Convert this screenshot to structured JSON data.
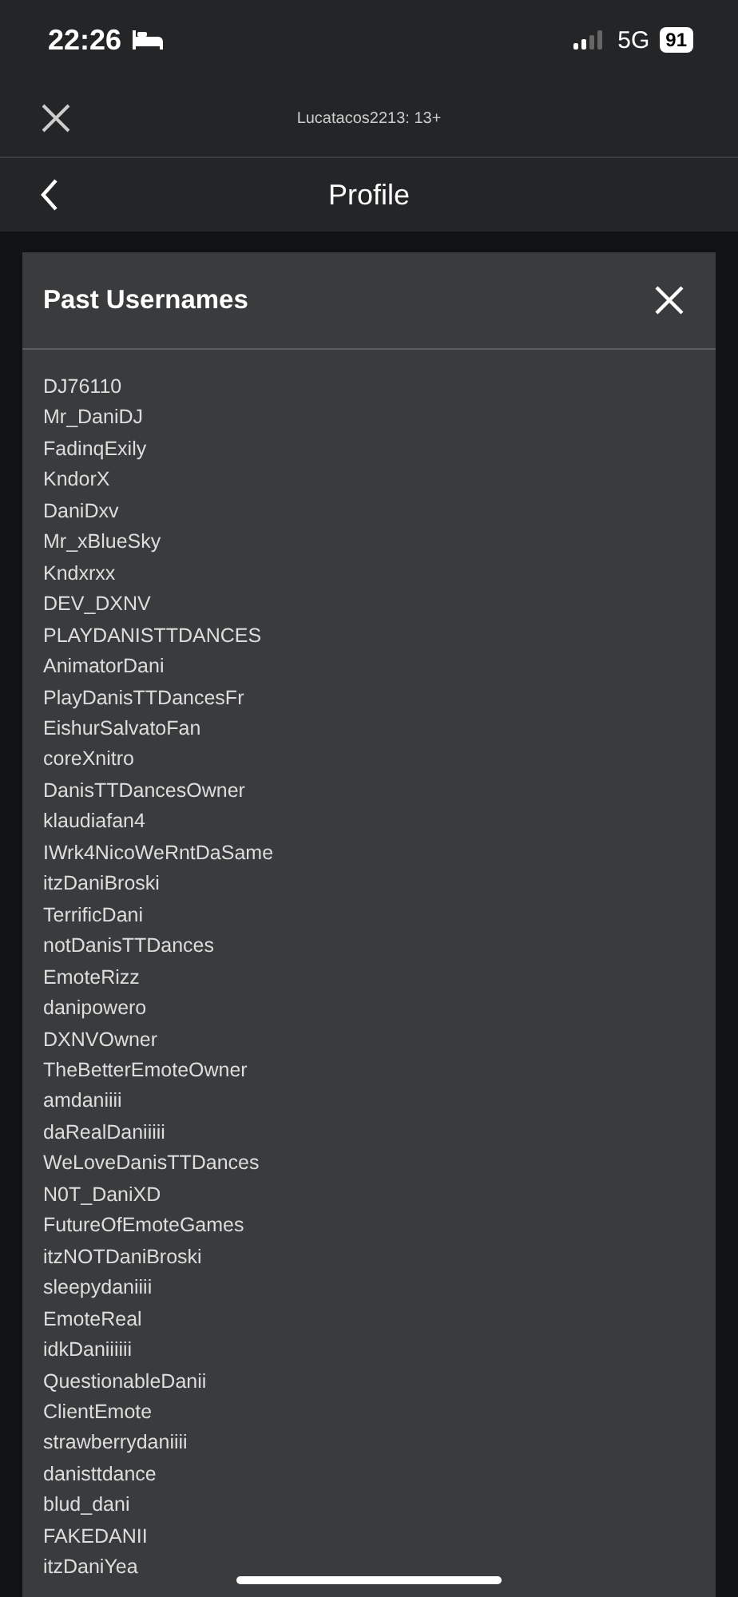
{
  "status_bar": {
    "time": "22:26",
    "network": "5G",
    "battery": "91"
  },
  "top_bar": {
    "title": "Lucatacos2213: 13+"
  },
  "header": {
    "title": "Profile"
  },
  "dialog": {
    "title": "Past Usernames",
    "usernames": [
      "DJ76110",
      "Mr_DaniDJ",
      "FadinqExily",
      "KndorX",
      "DaniDxv",
      "Mr_xBlueSky",
      "Kndxrxx",
      "DEV_DXNV",
      "PLAYDANISTTDANCES",
      "AnimatorDani",
      "PlayDanisTTDancesFr",
      "EishurSalvatoFan",
      "coreXnitro",
      "DanisTTDancesOwner",
      "klaudiafan4",
      "IWrk4NicoWeRntDaSame",
      "itzDaniBroski",
      "TerrificDani",
      "notDanisTTDances",
      "EmoteRizz",
      "danipowero",
      "DXNVOwner",
      "TheBetterEmoteOwner",
      "amdaniiii",
      "daRealDaniiiii",
      "WeLoveDanisTTDances",
      "N0T_DaniXD",
      "FutureOfEmoteGames",
      "itzNOTDaniBroski",
      "sleepydaniiii",
      "EmoteReal",
      "idkDaniiiiii",
      "QuestionableDanii",
      "ClientEmote",
      "strawberrydaniiii",
      "danisttdance",
      "blud_dani",
      "FAKEDANII",
      "itzDaniYea"
    ]
  }
}
